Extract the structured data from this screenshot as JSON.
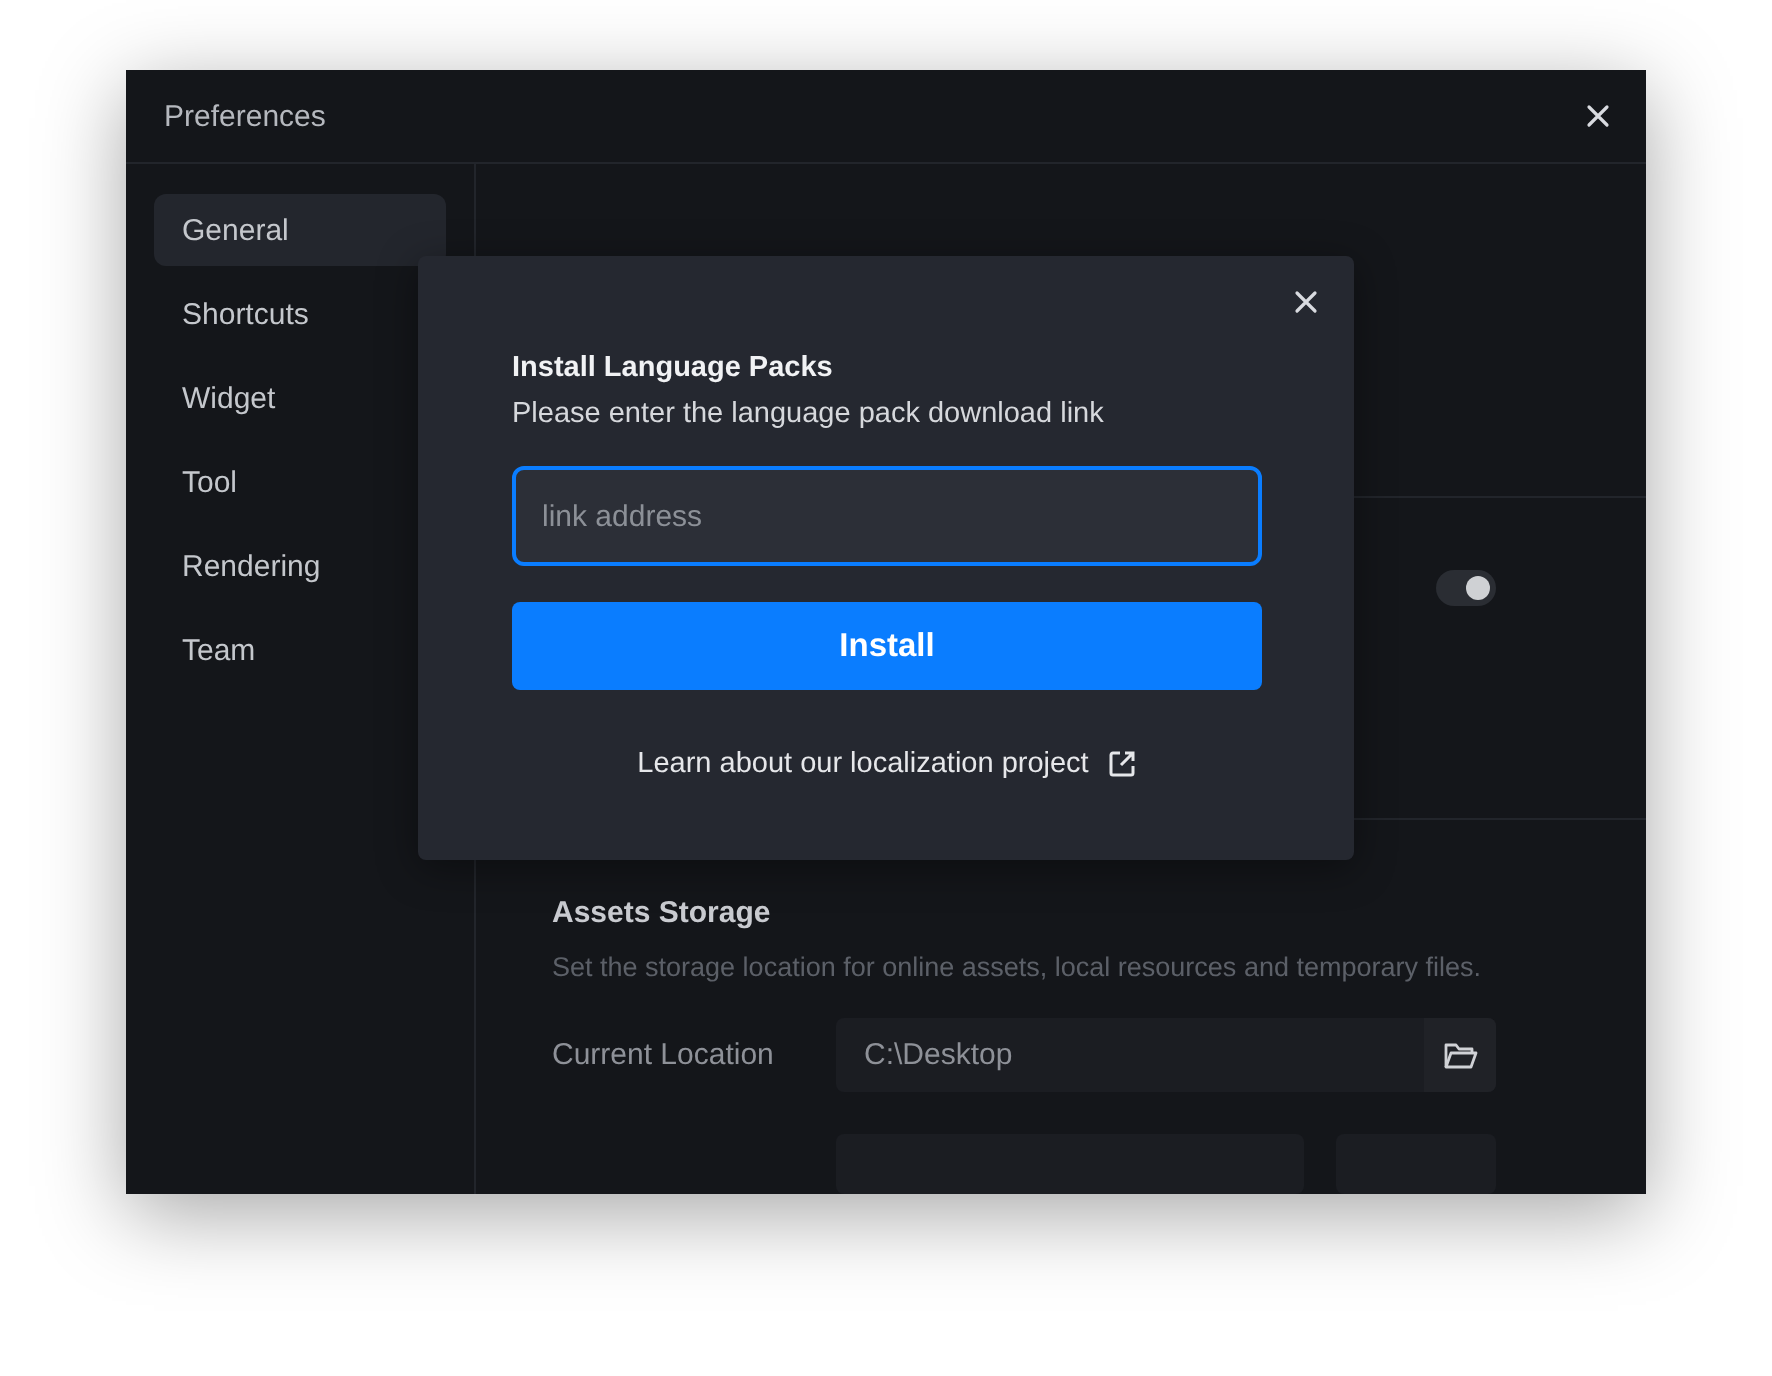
{
  "window": {
    "title": "Preferences"
  },
  "sidebar": {
    "items": [
      {
        "label": "General",
        "selected": true
      },
      {
        "label": "Shortcuts",
        "selected": false
      },
      {
        "label": "Widget",
        "selected": false
      },
      {
        "label": "Tool",
        "selected": false
      },
      {
        "label": "Rendering",
        "selected": false
      },
      {
        "label": "Team",
        "selected": false
      }
    ]
  },
  "content": {
    "toggle": {
      "on": true
    },
    "assets_storage": {
      "heading": "Assets Storage",
      "description": "Set the storage location for online assets, local resources and temporary files.",
      "current_location": {
        "label": "Current Location",
        "value": "C:\\Desktop"
      }
    }
  },
  "dialog": {
    "title": "Install Language Packs",
    "message": "Please enter the language pack download link",
    "field": {
      "placeholder": "link address"
    },
    "button": "Install",
    "link": "Learn about our localization project"
  }
}
